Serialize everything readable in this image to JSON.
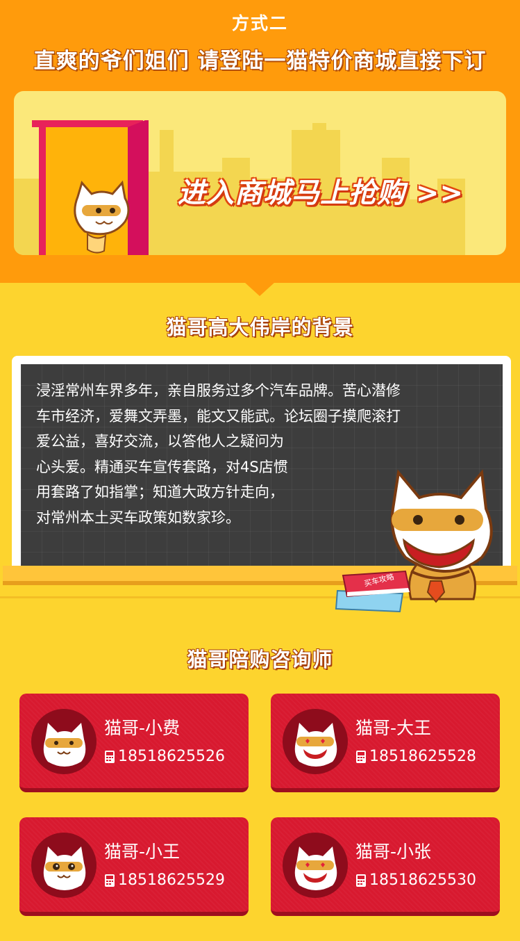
{
  "header": {
    "method": "方式二",
    "headline": "直爽的爷们姐们  请登陆一猫特价商城直接下订"
  },
  "banner": {
    "cta": "进入商城马上抢购 >>"
  },
  "background_section": {
    "title": "猫哥高大伟岸的背景",
    "lines": [
      "浸淫常州车界多年，亲自服务过多个汽车品牌。苦心潜修",
      "车市经济，爱舞文弄墨，能文又能武。论坛圈子摸爬滚打",
      "爱公益，喜好交流，以答他人之疑问为",
      "心头爱。精通买车宣传套路，对4S店惯",
      "用套路了如指掌；知道大政方针走向，",
      "对常州本土买车政策如数家珍。"
    ],
    "book_label": "买车攻略"
  },
  "consultants": {
    "title": "猫哥陪购咨询师",
    "items": [
      {
        "name": "猫哥-小费",
        "phone": "18518625526"
      },
      {
        "name": "猫哥-大王",
        "phone": "18518625528"
      },
      {
        "name": "猫哥-小王",
        "phone": "18518625529"
      },
      {
        "name": "猫哥-小张",
        "phone": "18518625530"
      }
    ]
  },
  "colors": {
    "orange": "#FF9B0C",
    "yellow": "#FDD42E",
    "card_red": "#D8192F",
    "board": "#3D3D3D"
  }
}
